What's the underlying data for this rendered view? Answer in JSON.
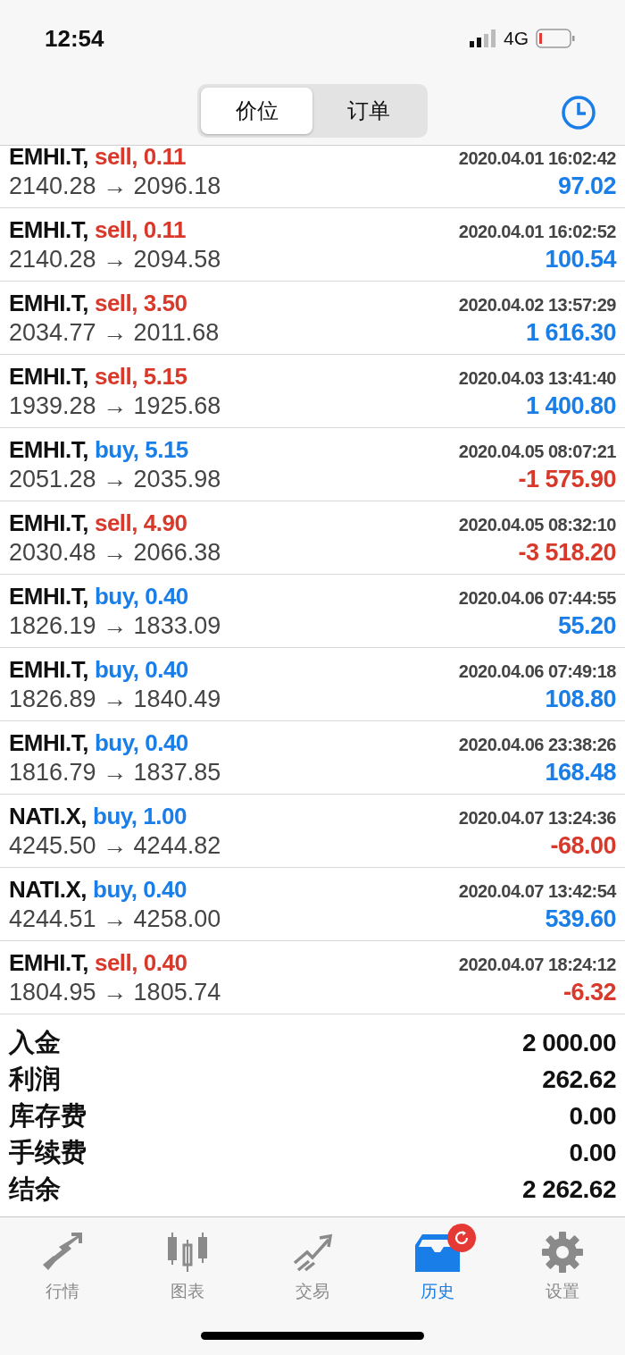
{
  "status_bar": {
    "time": "12:54",
    "network": "4G"
  },
  "segments": [
    {
      "label": "价位",
      "selected": true
    },
    {
      "label": "订单",
      "selected": false
    }
  ],
  "trades": [
    {
      "symbol": "EMHI.T,",
      "order": "sell, 0.11",
      "kind": "sell",
      "time": "2020.04.01 16:02:42",
      "prices": "2140.28 → 2096.18",
      "profit": "97.02",
      "loss": false
    },
    {
      "symbol": "EMHI.T,",
      "order": "sell, 0.11",
      "kind": "sell",
      "time": "2020.04.01 16:02:52",
      "prices": "2140.28 → 2094.58",
      "profit": "100.54",
      "loss": false
    },
    {
      "symbol": "EMHI.T,",
      "order": "sell, 3.50",
      "kind": "sell",
      "time": "2020.04.02 13:57:29",
      "prices": "2034.77 → 2011.68",
      "profit": "1 616.30",
      "loss": false
    },
    {
      "symbol": "EMHI.T,",
      "order": "sell, 5.15",
      "kind": "sell",
      "time": "2020.04.03 13:41:40",
      "prices": "1939.28 → 1925.68",
      "profit": "1 400.80",
      "loss": false
    },
    {
      "symbol": "EMHI.T,",
      "order": "buy, 5.15",
      "kind": "buy",
      "time": "2020.04.05 08:07:21",
      "prices": "2051.28 → 2035.98",
      "profit": "-1 575.90",
      "loss": true
    },
    {
      "symbol": "EMHI.T,",
      "order": "sell, 4.90",
      "kind": "sell",
      "time": "2020.04.05 08:32:10",
      "prices": "2030.48 → 2066.38",
      "profit": "-3 518.20",
      "loss": true
    },
    {
      "symbol": "EMHI.T,",
      "order": "buy, 0.40",
      "kind": "buy",
      "time": "2020.04.06 07:44:55",
      "prices": "1826.19 → 1833.09",
      "profit": "55.20",
      "loss": false
    },
    {
      "symbol": "EMHI.T,",
      "order": "buy, 0.40",
      "kind": "buy",
      "time": "2020.04.06 07:49:18",
      "prices": "1826.89 → 1840.49",
      "profit": "108.80",
      "loss": false
    },
    {
      "symbol": "EMHI.T,",
      "order": "buy, 0.40",
      "kind": "buy",
      "time": "2020.04.06 23:38:26",
      "prices": "1816.79 → 1837.85",
      "profit": "168.48",
      "loss": false
    },
    {
      "symbol": "NATI.X,",
      "order": "buy, 1.00",
      "kind": "buy",
      "time": "2020.04.07 13:24:36",
      "prices": "4245.50 → 4244.82",
      "profit": "-68.00",
      "loss": true
    },
    {
      "symbol": "NATI.X,",
      "order": "buy, 0.40",
      "kind": "buy",
      "time": "2020.04.07 13:42:54",
      "prices": "4244.51 → 4258.00",
      "profit": "539.60",
      "loss": false
    },
    {
      "symbol": "EMHI.T,",
      "order": "sell, 0.40",
      "kind": "sell",
      "time": "2020.04.07 18:24:12",
      "prices": "1804.95 → 1805.74",
      "profit": "-6.32",
      "loss": true
    }
  ],
  "summary": [
    {
      "label": "入金",
      "value": "2 000.00"
    },
    {
      "label": "利润",
      "value": "262.62"
    },
    {
      "label": "库存费",
      "value": "0.00"
    },
    {
      "label": "手续费",
      "value": "0.00"
    },
    {
      "label": "结余",
      "value": "2 262.62"
    }
  ],
  "tab_bar": [
    {
      "label": "行情",
      "kind": "quotes",
      "selected": false,
      "badge": false
    },
    {
      "label": "图表",
      "kind": "chart",
      "selected": false,
      "badge": false
    },
    {
      "label": "交易",
      "kind": "trade",
      "selected": false,
      "badge": false
    },
    {
      "label": "历史",
      "kind": "history",
      "selected": true,
      "badge": true
    },
    {
      "label": "设置",
      "kind": "settings",
      "selected": false,
      "badge": false
    }
  ]
}
